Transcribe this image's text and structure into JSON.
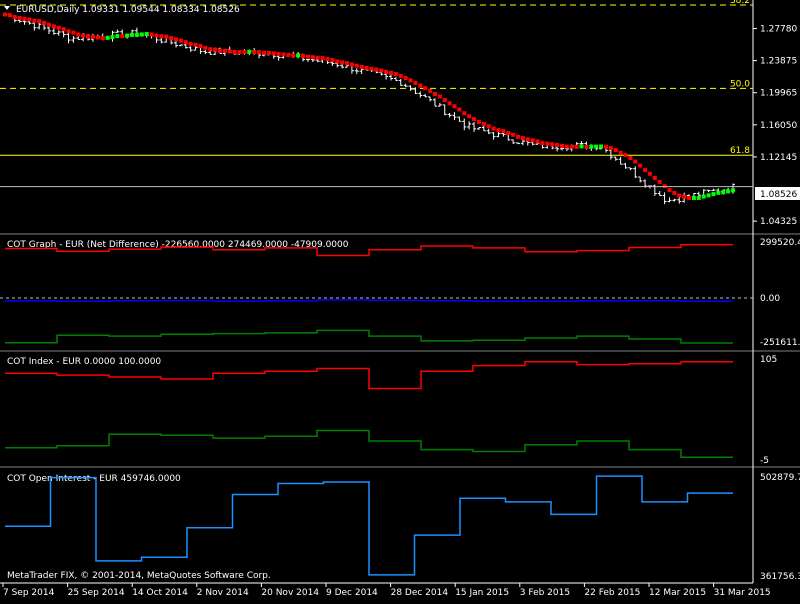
{
  "window": {
    "symbol_header": "EURUSD,Daily  1.09331 1.09544 1.08334 1.08526",
    "copyright": "MetaTrader FIX, © 2001-2014, MetaQuotes Software Corp."
  },
  "colors": {
    "background": "#000000",
    "foreground": "#ffffff",
    "grid_separator": "#808080",
    "fib_line": "#ffff00",
    "current_price_line": "#c0c0c0",
    "ma_down": "#ff0000",
    "ma_up": "#00ff00",
    "cot_long": "#ff0000",
    "cot_short": "#008000",
    "cot_net": "#0000ff",
    "open_interest": "#1e90ff"
  },
  "price_axis": {
    "ticks": [
      "1.27780",
      "1.23875",
      "1.19965",
      "1.16050",
      "1.12145",
      "1.04325"
    ],
    "current_price": "1.08526",
    "fib_levels": [
      {
        "label": "38.2",
        "price": 1.3065,
        "style": "dashed"
      },
      {
        "label": "50.0",
        "price": 1.205,
        "style": "dashed"
      },
      {
        "label": "61.8",
        "price": 1.1235,
        "style": "solid"
      }
    ]
  },
  "time_axis": {
    "labels": [
      "7 Sep 2014",
      "25 Sep 2014",
      "14 Oct 2014",
      "2 Nov 2014",
      "20 Nov 2014",
      "9 Dec 2014",
      "28 Dec 2014",
      "15 Jan 2015",
      "3 Feb 2015",
      "22 Feb 2015",
      "12 Mar 2015",
      "31 Mar 2015"
    ]
  },
  "panels": {
    "cot_graph": {
      "title": "COT Graph - EUR (Net Difference)  -226560.0000 274469.0000 -47909.0000",
      "axis_top": "299520.4",
      "axis_mid": "0.00",
      "axis_bottom": "-251611.4"
    },
    "cot_index": {
      "title": "COT Index - EUR 0.0000 100.0000",
      "axis_top": "105",
      "axis_bottom": "-5"
    },
    "open_interest": {
      "title": "COT Open Interest - EUR  459746.0000",
      "axis_top": "502879.7",
      "axis_bottom": "361756.3"
    }
  },
  "chart_data": [
    {
      "type": "line",
      "subtype": "ohlc-bars",
      "title": "EURUSD,Daily",
      "description_values": {
        "open": 1.09331,
        "high": 1.09544,
        "low": 1.08334,
        "close": 1.08526
      },
      "x": [
        "2014-09-07",
        "2014-09-25",
        "2014-10-14",
        "2014-11-02",
        "2014-11-20",
        "2014-12-09",
        "2014-12-28",
        "2015-01-15",
        "2015-02-03",
        "2015-02-22",
        "2015-03-12",
        "2015-03-31"
      ],
      "series": [
        {
          "values": [
            1.295,
            1.266,
            1.272,
            1.25,
            1.248,
            1.235,
            1.212,
            1.158,
            1.135,
            1.135,
            1.068,
            1.085
          ]
        }
      ],
      "ylim": [
        1.03,
        1.3065
      ],
      "grid": false
    },
    {
      "type": "line",
      "title": "COT Graph - EUR (Net Difference)",
      "ylim": [
        -251611.4,
        299520.4
      ],
      "series": [
        {
          "values": [
            255000,
            240000,
            252000,
            262000,
            248000,
            258000,
            218000,
            248000,
            268000,
            258000,
            238000,
            244000,
            260000,
            274469
          ]
        },
        {
          "values": [
            -20000,
            -22000,
            -19000,
            -18000,
            -21000,
            -20000,
            -15000,
            -17000,
            -19000,
            -21000,
            -22000,
            -20000,
            -19000,
            -22000
          ]
        },
        {
          "values": [
            -240000,
            -200000,
            -205000,
            -195000,
            -192000,
            -188000,
            -175000,
            -205000,
            -230000,
            -226560,
            -215000,
            -205000,
            -220000,
            -241000
          ]
        }
      ]
    },
    {
      "type": "line",
      "title": "COT Index - EUR",
      "ylim": [
        -5,
        105
      ],
      "series": [
        {
          "values": [
            88,
            86,
            84,
            82,
            88,
            90,
            93,
            72,
            90,
            96,
            100,
            97,
            98,
            100
          ]
        },
        {
          "values": [
            10,
            12,
            24,
            23,
            20,
            22,
            28,
            17,
            8,
            6,
            13,
            17,
            8,
            0
          ]
        }
      ]
    },
    {
      "type": "line",
      "title": "COT Open Interest - EUR",
      "ylim": [
        361756.3,
        502879.7
      ],
      "series": [
        {
          "values": [
            432000,
            498000,
            385000,
            390000,
            430000,
            475000,
            490000,
            492000,
            366000,
            420000,
            470000,
            465000,
            448000,
            500000,
            465000,
            477000
          ]
        }
      ]
    }
  ]
}
